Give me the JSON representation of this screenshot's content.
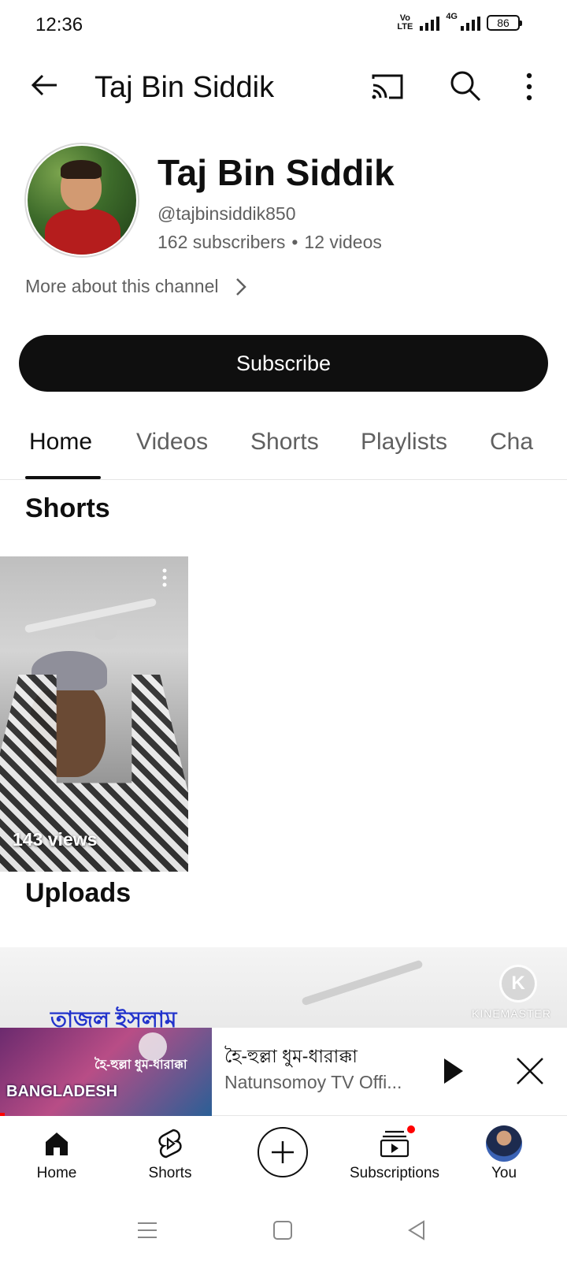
{
  "status_bar": {
    "time": "12:36",
    "volte": "Vo\nLTE",
    "network": "4G",
    "battery": "86"
  },
  "app_bar": {
    "title": "Taj Bin Siddik"
  },
  "channel": {
    "name": "Taj Bin Siddik",
    "handle": "@tajbinsiddik850",
    "subscribers": "162 subscribers",
    "separator": "•",
    "videos": "12 videos",
    "more_about": "More about this channel",
    "subscribe_label": "Subscribe"
  },
  "tabs": [
    {
      "label": "Home",
      "active": true
    },
    {
      "label": "Videos",
      "active": false
    },
    {
      "label": "Shorts",
      "active": false
    },
    {
      "label": "Playlists",
      "active": false
    },
    {
      "label": "Cha",
      "active": false
    }
  ],
  "sections": {
    "shorts_title": "Shorts",
    "uploads_title": "Uploads"
  },
  "shorts": [
    {
      "views": "143 views"
    }
  ],
  "uploads": [
    {
      "overlay_text": "তাজল ইসলাম",
      "watermark_logo": "K",
      "watermark_text": "KINEMASTER"
    }
  ],
  "mini_player": {
    "title": "হৈ-হুল্লা ধুম-ধারাক্কা",
    "channel": "Natunsomoy TV Offi...",
    "thumb_text_main": "BANGLADESH",
    "thumb_text_song": "হৈ-হুল্লা ধুম-ধারাক্কা"
  },
  "bottom_nav": [
    {
      "label": "Home",
      "icon": "home-icon"
    },
    {
      "label": "Shorts",
      "icon": "shorts-icon"
    },
    {
      "label": "",
      "icon": "create-icon"
    },
    {
      "label": "Subscriptions",
      "icon": "subscriptions-icon"
    },
    {
      "label": "You",
      "icon": "you-avatar"
    }
  ],
  "colors": {
    "text_primary": "#0f0f0f",
    "text_secondary": "#606060",
    "accent_red": "#ff0000",
    "subscribe_bg": "#0f0f0f"
  }
}
